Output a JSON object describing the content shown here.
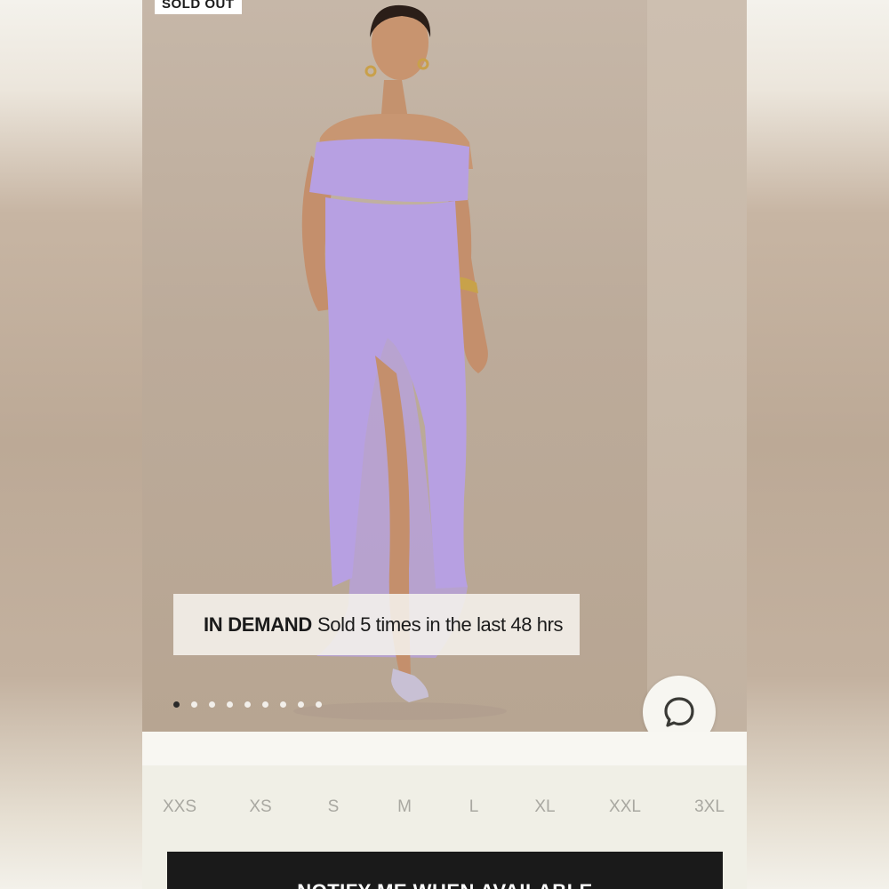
{
  "product": {
    "badge": "SOLD OUT",
    "dress_color": "#b7a0e2"
  },
  "banner": {
    "label": "IN DEMAND",
    "message": "Sold 5 times in the last 48 hrs"
  },
  "carousel": {
    "total": 9,
    "active_index": 0
  },
  "chat": {
    "icon": "chat-bubble-icon"
  },
  "sizes": [
    "XXS",
    "XS",
    "S",
    "M",
    "L",
    "XL",
    "XXL",
    "3XL"
  ],
  "cta": {
    "label": "NOTIFY ME WHEN AVAILABLE"
  },
  "colors": {
    "cta_background": "#1a1a1a",
    "size_text": "#a9a8a1",
    "backdrop": "#bcab9a"
  }
}
